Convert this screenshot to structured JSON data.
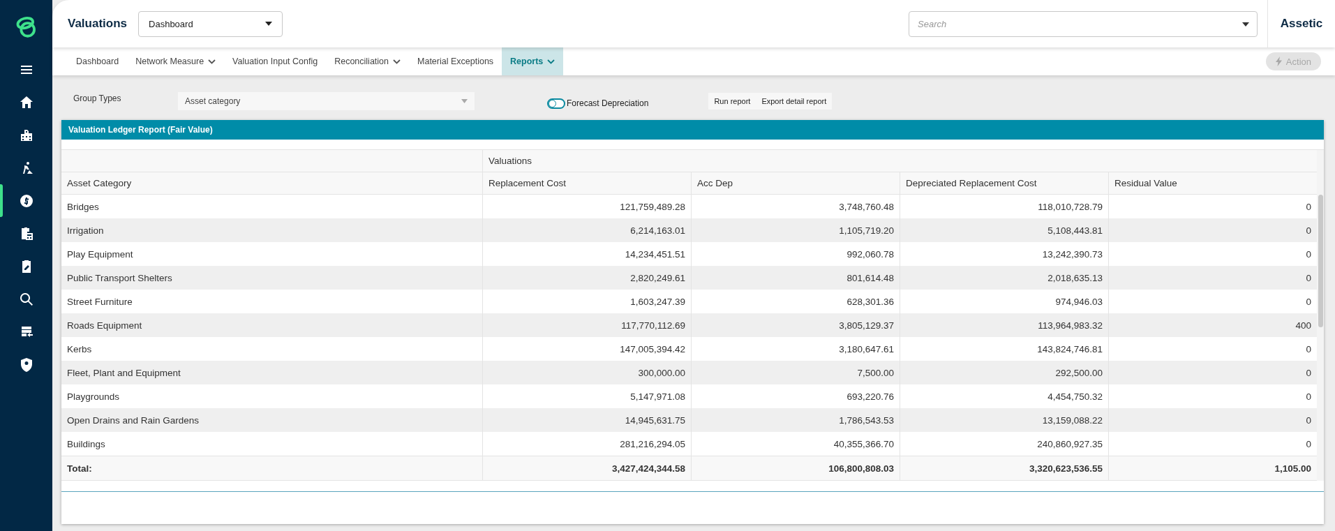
{
  "sidebar": {
    "items": [
      {
        "selected": false
      },
      {
        "selected": false
      },
      {
        "selected": false
      },
      {
        "selected": false
      },
      {
        "selected": true
      },
      {
        "selected": false
      },
      {
        "selected": false
      },
      {
        "selected": false
      },
      {
        "selected": false
      },
      {
        "selected": false
      }
    ]
  },
  "header": {
    "title": "Valuations",
    "view_select": "Dashboard",
    "search": {
      "placeholder": "Search"
    },
    "brand": "Assetic"
  },
  "tabs": [
    {
      "label": "Dashboard",
      "has_menu": false,
      "selected": false
    },
    {
      "label": "Network Measure",
      "has_menu": true,
      "selected": false
    },
    {
      "label": "Valuation Input Config",
      "has_menu": false,
      "selected": false
    },
    {
      "label": "Reconciliation",
      "has_menu": true,
      "selected": false
    },
    {
      "label": "Material Exceptions",
      "has_menu": false,
      "selected": false
    },
    {
      "label": "Reports",
      "has_menu": true,
      "selected": true
    }
  ],
  "action_button": {
    "label": "Action",
    "disabled": true
  },
  "controls": {
    "group_types_label": "Group Types",
    "group_types_value": "Asset category",
    "forecast": {
      "label": "Forecast Depreciation",
      "on": false
    },
    "buttons": [
      "Run report",
      "Export detail report"
    ]
  },
  "report": {
    "title": "Valuation Ledger Report (Fair Value)",
    "group_header": "Valuations",
    "columns": [
      "Asset Category",
      "Replacement Cost",
      "Acc Dep",
      "Depreciated Replacement Cost",
      "Residual Value"
    ],
    "rows": [
      [
        "Bridges",
        "121,759,489.28",
        "3,748,760.48",
        "118,010,728.79",
        "0"
      ],
      [
        "Irrigation",
        "6,214,163.01",
        "1,105,719.20",
        "5,108,443.81",
        "0"
      ],
      [
        "Play Equipment",
        "14,234,451.51",
        "992,060.78",
        "13,242,390.73",
        "0"
      ],
      [
        "Public Transport Shelters",
        "2,820,249.61",
        "801,614.48",
        "2,018,635.13",
        "0"
      ],
      [
        "Street Furniture",
        "1,603,247.39",
        "628,301.36",
        "974,946.03",
        "0"
      ],
      [
        "Roads Equipment",
        "117,770,112.69",
        "3,805,129.37",
        "113,964,983.32",
        "400"
      ],
      [
        "Kerbs",
        "147,005,394.42",
        "3,180,647.61",
        "143,824,746.81",
        "0"
      ],
      [
        "Fleet, Plant and Equipment",
        "300,000.00",
        "7,500.00",
        "292,500.00",
        "0"
      ],
      [
        "Playgrounds",
        "5,147,971.08",
        "693,220.76",
        "4,454,750.32",
        "0"
      ],
      [
        "Open Drains and Rain Gardens",
        "14,945,631.75",
        "1,786,543.53",
        "13,159,088.22",
        "0"
      ],
      [
        "Buildings",
        "281,216,294.05",
        "40,355,366.70",
        "240,860,927.35",
        "0"
      ]
    ],
    "total": [
      "Total:",
      "3,427,424,344.58",
      "106,800,808.03",
      "3,320,623,536.55",
      "1,105.00"
    ]
  }
}
